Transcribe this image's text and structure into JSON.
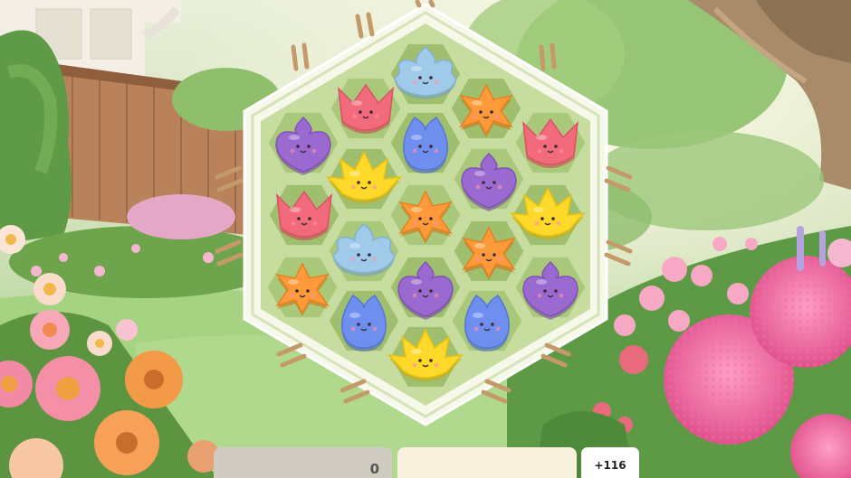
{
  "board": {
    "tiles": [
      {
        "id": "t-top",
        "type": "bud",
        "color": "#9fcaea"
      },
      {
        "id": "t-r1-l",
        "type": "tulip",
        "color": "#f26b7c"
      },
      {
        "id": "t-r1-r",
        "type": "star",
        "color": "#ff9a3a"
      },
      {
        "id": "t-r2-a",
        "type": "heart",
        "color": "#9a6ad0"
      },
      {
        "id": "t-r2-b",
        "type": "drop",
        "color": "#6f8fef"
      },
      {
        "id": "t-r2-c",
        "type": "tulip",
        "color": "#f26b7c"
      },
      {
        "id": "t-r3-a",
        "type": "lotus",
        "color": "#ffd92a"
      },
      {
        "id": "t-r3-b",
        "type": "heart",
        "color": "#9a6ad0"
      },
      {
        "id": "t-r4-a",
        "type": "tulip",
        "color": "#f26b7c"
      },
      {
        "id": "t-r4-b",
        "type": "star",
        "color": "#ff9a3a"
      },
      {
        "id": "t-r4-c",
        "type": "lotus",
        "color": "#ffd92a"
      },
      {
        "id": "t-r5-a",
        "type": "bud",
        "color": "#9fcaea"
      },
      {
        "id": "t-r5-b",
        "type": "star",
        "color": "#ff9a3a"
      },
      {
        "id": "t-r6-a",
        "type": "star",
        "color": "#ff9a3a"
      },
      {
        "id": "t-r6-b",
        "type": "heart",
        "color": "#9a6ad0"
      },
      {
        "id": "t-r6-c",
        "type": "heart",
        "color": "#9a6ad0"
      },
      {
        "id": "t-r7-a",
        "type": "drop",
        "color": "#6f8fef"
      },
      {
        "id": "t-r7-b",
        "type": "drop",
        "color": "#6f8fef"
      },
      {
        "id": "t-bottom",
        "type": "lotus",
        "color": "#ffd92a"
      }
    ]
  },
  "hud": {
    "water_icon": "watering-can-icon",
    "water_count": "0",
    "seed_icon": "lavender-icon",
    "score": "+116"
  }
}
